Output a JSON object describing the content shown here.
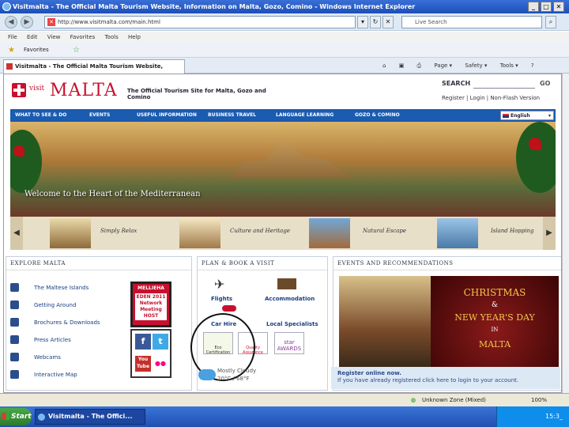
{
  "window": {
    "title": "Visitmalta - The Official Malta Tourism Website, Information on Malta, Gozo, Comino - Windows Internet Explorer"
  },
  "address": {
    "url": "http://www.visitmalta.com/main.html",
    "search_placeholder": "Live Search"
  },
  "menu": [
    "File",
    "Edit",
    "View",
    "Favorites",
    "Tools",
    "Help"
  ],
  "favorites": {
    "label": "Favorites"
  },
  "tab": {
    "label": "Visitmalta - The Official Malta Tourism Website, Inform..."
  },
  "toolbar": {
    "page": "Page ▾",
    "safety": "Safety ▾",
    "tools": "Tools ▾",
    "help": "?"
  },
  "site": {
    "visit": "visit",
    "malta": "MALTA",
    "tagline": "The Official Tourism Site for Malta, Gozo and Comino",
    "search_label": "SEARCH",
    "go": "GO",
    "links": "Register | Login | Non-Flash Version",
    "nav": [
      "WHAT TO SEE & DO",
      "EVENTS",
      "USEFUL INFORMATION",
      "BUSINESS TRAVEL",
      "LANGUAGE LEARNING",
      "GOZO & COMINO"
    ],
    "language": "English",
    "welcome": "Welcome to the Heart of the Mediterranean",
    "strip": [
      "Simply Relax",
      "Culture and Heritage",
      "Natural Escape",
      "Island Hopping"
    ],
    "explore": {
      "title": "EXPLORE MALTA",
      "items": [
        "The Maltese Islands",
        "Getting Around",
        "Brochures & Downloads",
        "Press Articles",
        "Webcams",
        "Interactive Map"
      ]
    },
    "mellieha": {
      "top": "MELLIEHA",
      "line1": "EDEN 2011",
      "line2": "Network",
      "line3": "Meeting",
      "line4": "HOST"
    },
    "social": {
      "facebook": "f",
      "twitter": "t",
      "youtube": "You Tube",
      "flickr": "●●"
    },
    "plan": {
      "title": "PLAN & BOOK A VISIT",
      "flights": "Flights",
      "accommodation": "Accommodation",
      "car_hire": "Car Hire",
      "local": "Local Specialists",
      "eco": "Eco Certification",
      "quality": "Quality Assurance",
      "star": "star AWARDS"
    },
    "weather": {
      "line1": "Mostly Cloudy",
      "line2": "20°C / 68°F"
    },
    "events": {
      "title": "EVENTS AND RECOMMENDATIONS"
    },
    "xmas": {
      "l1": "CHRISTMAS",
      "l2": "&",
      "l3": "NEW YEAR'S DAY",
      "l4": "IN",
      "l5": "MALTA"
    },
    "register": {
      "l1": "Register online now.",
      "l2": "If you have already registered click here to login to your account."
    }
  },
  "status": {
    "zone": "Unknown Zone (Mixed)",
    "zoom": "100%"
  },
  "taskbar": {
    "start": "Start",
    "item": "Visitmalta - The Offici...",
    "clock": "15:3_"
  }
}
